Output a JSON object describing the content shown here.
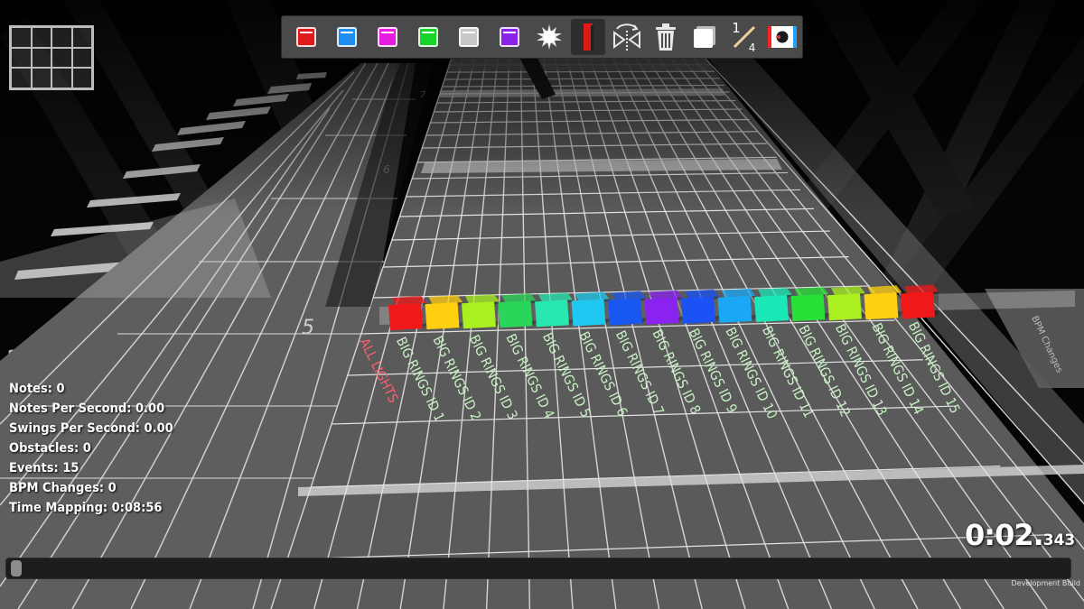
{
  "toolbar": {
    "items": [
      {
        "name": "red-note-button",
        "icon": "red-note-icon",
        "color": "#e01a1a"
      },
      {
        "name": "blue-note-button",
        "icon": "blue-note-icon",
        "color": "#1e8ff0"
      },
      {
        "name": "magenta-note-button",
        "icon": "magenta-note-icon",
        "color": "#e81ce0"
      },
      {
        "name": "green-note-button",
        "icon": "green-note-icon",
        "color": "#18d428"
      },
      {
        "name": "white-note-button",
        "icon": "white-note-icon",
        "color": "#c8c8c8"
      },
      {
        "name": "purple-note-button",
        "icon": "purple-note-icon",
        "color": "#8b22e8"
      }
    ],
    "precision_numerator": "1",
    "precision_denominator": "4"
  },
  "track": {
    "beat_numbers": [
      "7",
      "6",
      "5"
    ],
    "lane_labels": [
      "ALL LIGHTS",
      "BIG RINGS ID 1",
      "BIG RINGS ID 2",
      "BIG RINGS ID 3",
      "BIG RINGS ID 4",
      "BIG RINGS ID 5",
      "BIG RINGS ID 6",
      "BIG RINGS ID 7",
      "BIG RINGS ID 8",
      "BIG RINGS ID 9",
      "BIG RINGS ID 10",
      "BIG RINGS ID 11",
      "BIG RINGS ID 12",
      "BIG RINGS ID 13",
      "BIG RINGS ID 14",
      "BIG RINGS ID 15"
    ],
    "label_colors": {
      "all_lights": "#ff5f6a",
      "rings": "#c8f2c4"
    },
    "event_block_colors": [
      "#f01818",
      "#ffcf10",
      "#a8f020",
      "#2ad65a",
      "#28e8b0",
      "#1fc8f0",
      "#1858f0",
      "#8a22f0",
      "#1a52f5",
      "#1aa8f5",
      "#1ae8b8",
      "#28e038",
      "#aaf020",
      "#ffd010",
      "#f01818"
    ],
    "side_label": "BPM Changes"
  },
  "stats": [
    {
      "key": "notes",
      "text": "Notes: 0"
    },
    {
      "key": "nps",
      "text": "Notes Per Second: 0.00"
    },
    {
      "key": "sps",
      "text": "Swings Per Second: 0.00"
    },
    {
      "key": "obstacles",
      "text": "Obstacles: 0"
    },
    {
      "key": "events",
      "text": "Events: 15"
    },
    {
      "key": "bpm",
      "text": "BPM Changes: 0"
    },
    {
      "key": "time_mapping",
      "text": "Time Mapping: 0:08:56"
    }
  ],
  "timer": {
    "main": "0:02.",
    "fraction": "343"
  },
  "dev_build": "Development Build"
}
